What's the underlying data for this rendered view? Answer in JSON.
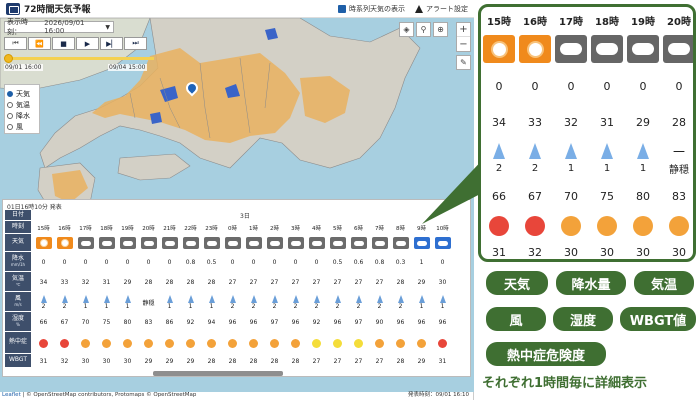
{
  "app": {
    "title": "72時間天気予報",
    "timeseries_label": "時系列天気の表示",
    "alert_label": "アラート設定"
  },
  "controls": {
    "display_time_label": "表示時刻：",
    "display_time_value": "2026/09/01 16:00",
    "slider_start": "09/01 16:00",
    "slider_end": "09/04 15:00"
  },
  "layers": [
    {
      "label": "天気",
      "selected": true
    },
    {
      "label": "気温",
      "selected": false
    },
    {
      "label": "降水",
      "selected": false
    },
    {
      "label": "風",
      "selected": false
    }
  ],
  "table": {
    "issued": "01日16時10分 発表",
    "day_label": "3日",
    "row_headers": [
      {
        "main": "日付",
        "sub": ""
      },
      {
        "main": "時刻",
        "sub": ""
      },
      {
        "main": "天気",
        "sub": ""
      },
      {
        "main": "降水",
        "sub": "mm/1h"
      },
      {
        "main": "気温",
        "sub": "℃"
      },
      {
        "main": "風",
        "sub": "m/s"
      },
      {
        "main": "湿度",
        "sub": "%"
      },
      {
        "main": "熱中症",
        "sub": ""
      },
      {
        "main": "WBGT",
        "sub": ""
      }
    ],
    "hours": [
      "15時",
      "16時",
      "17時",
      "18時",
      "19時",
      "20時",
      "21時",
      "22時",
      "23時",
      "0時",
      "1時",
      "2時",
      "3時",
      "4時",
      "5時",
      "6時",
      "7時",
      "8時",
      "9時",
      "10時"
    ],
    "weather": [
      "sun",
      "sun",
      "cloud",
      "cloud",
      "cloud",
      "cloud",
      "cloud",
      "cloud",
      "cloud",
      "cloud",
      "cloud",
      "cloud",
      "cloud",
      "cloud",
      "cloud",
      "cloud",
      "cloud",
      "cloud",
      "rain",
      "rain"
    ],
    "rain": [
      "0",
      "0",
      "0",
      "0",
      "0",
      "0",
      "0",
      "0.8",
      "0.5",
      "0",
      "0",
      "0",
      "0",
      "0",
      "0.5",
      "0.6",
      "0.8",
      "0.3",
      "1",
      "0"
    ],
    "temp": [
      "34",
      "33",
      "32",
      "31",
      "29",
      "28",
      "28",
      "28",
      "28",
      "27",
      "27",
      "27",
      "27",
      "27",
      "27",
      "27",
      "27",
      "28",
      "29",
      "30"
    ],
    "wind_speed": [
      "2",
      "2",
      "1",
      "1",
      "1",
      "静穏",
      "1",
      "1",
      "1",
      "2",
      "2",
      "2",
      "2",
      "2",
      "2",
      "2",
      "2",
      "2",
      "1",
      "1"
    ],
    "humidity": [
      "66",
      "67",
      "70",
      "75",
      "80",
      "83",
      "86",
      "92",
      "94",
      "96",
      "96",
      "97",
      "96",
      "92",
      "96",
      "97",
      "90",
      "96",
      "96",
      "96"
    ],
    "heat_level": [
      "red",
      "red",
      "orange",
      "orange",
      "orange",
      "orange",
      "orange",
      "orange",
      "orange",
      "orange",
      "orange",
      "orange",
      "orange",
      "yellow",
      "yellow",
      "yellow",
      "orange",
      "orange",
      "orange",
      "red"
    ],
    "wbgt": [
      "31",
      "32",
      "30",
      "30",
      "30",
      "29",
      "29",
      "29",
      "28",
      "28",
      "28",
      "28",
      "28",
      "27",
      "27",
      "27",
      "27",
      "28",
      "29",
      "31"
    ]
  },
  "attribution": {
    "leaflet": "Leaflet",
    "text": " | © OpenStreetMap contributors, Protomaps © OpenStreetMap",
    "issued_bottom": "発表時刻：09/01 16:10"
  },
  "zoom": {
    "hours": [
      "15時",
      "16時",
      "17時",
      "18時",
      "19時",
      "20時"
    ],
    "weather": [
      "sun",
      "sun",
      "cloud",
      "cloud",
      "cloud",
      "cloud"
    ],
    "rain": [
      "0",
      "0",
      "0",
      "0",
      "0",
      "0"
    ],
    "temp": [
      "34",
      "33",
      "32",
      "31",
      "29",
      "28"
    ],
    "wind_speed": [
      "2",
      "2",
      "1",
      "1",
      "1",
      "静穏"
    ],
    "humidity": [
      "66",
      "67",
      "70",
      "75",
      "80",
      "83"
    ],
    "heat_level": [
      "red",
      "red",
      "orange",
      "orange",
      "orange",
      "orange"
    ],
    "wbgt": [
      "31",
      "32",
      "30",
      "30",
      "30",
      "30"
    ]
  },
  "legend": {
    "weather": "天気",
    "precip": "降水量",
    "temp": "気温",
    "wind": "風",
    "humidity": "湿度",
    "wbgt": "WBGT値",
    "heatstroke": "熱中症危険度",
    "caption": "それぞれ1時間毎に詳細表示"
  },
  "colors": {
    "accent_green": "#3f6f32",
    "header_navy": "#3e4f6b",
    "sun_orange": "#f08a1c",
    "danger_red": "#e8463a"
  }
}
